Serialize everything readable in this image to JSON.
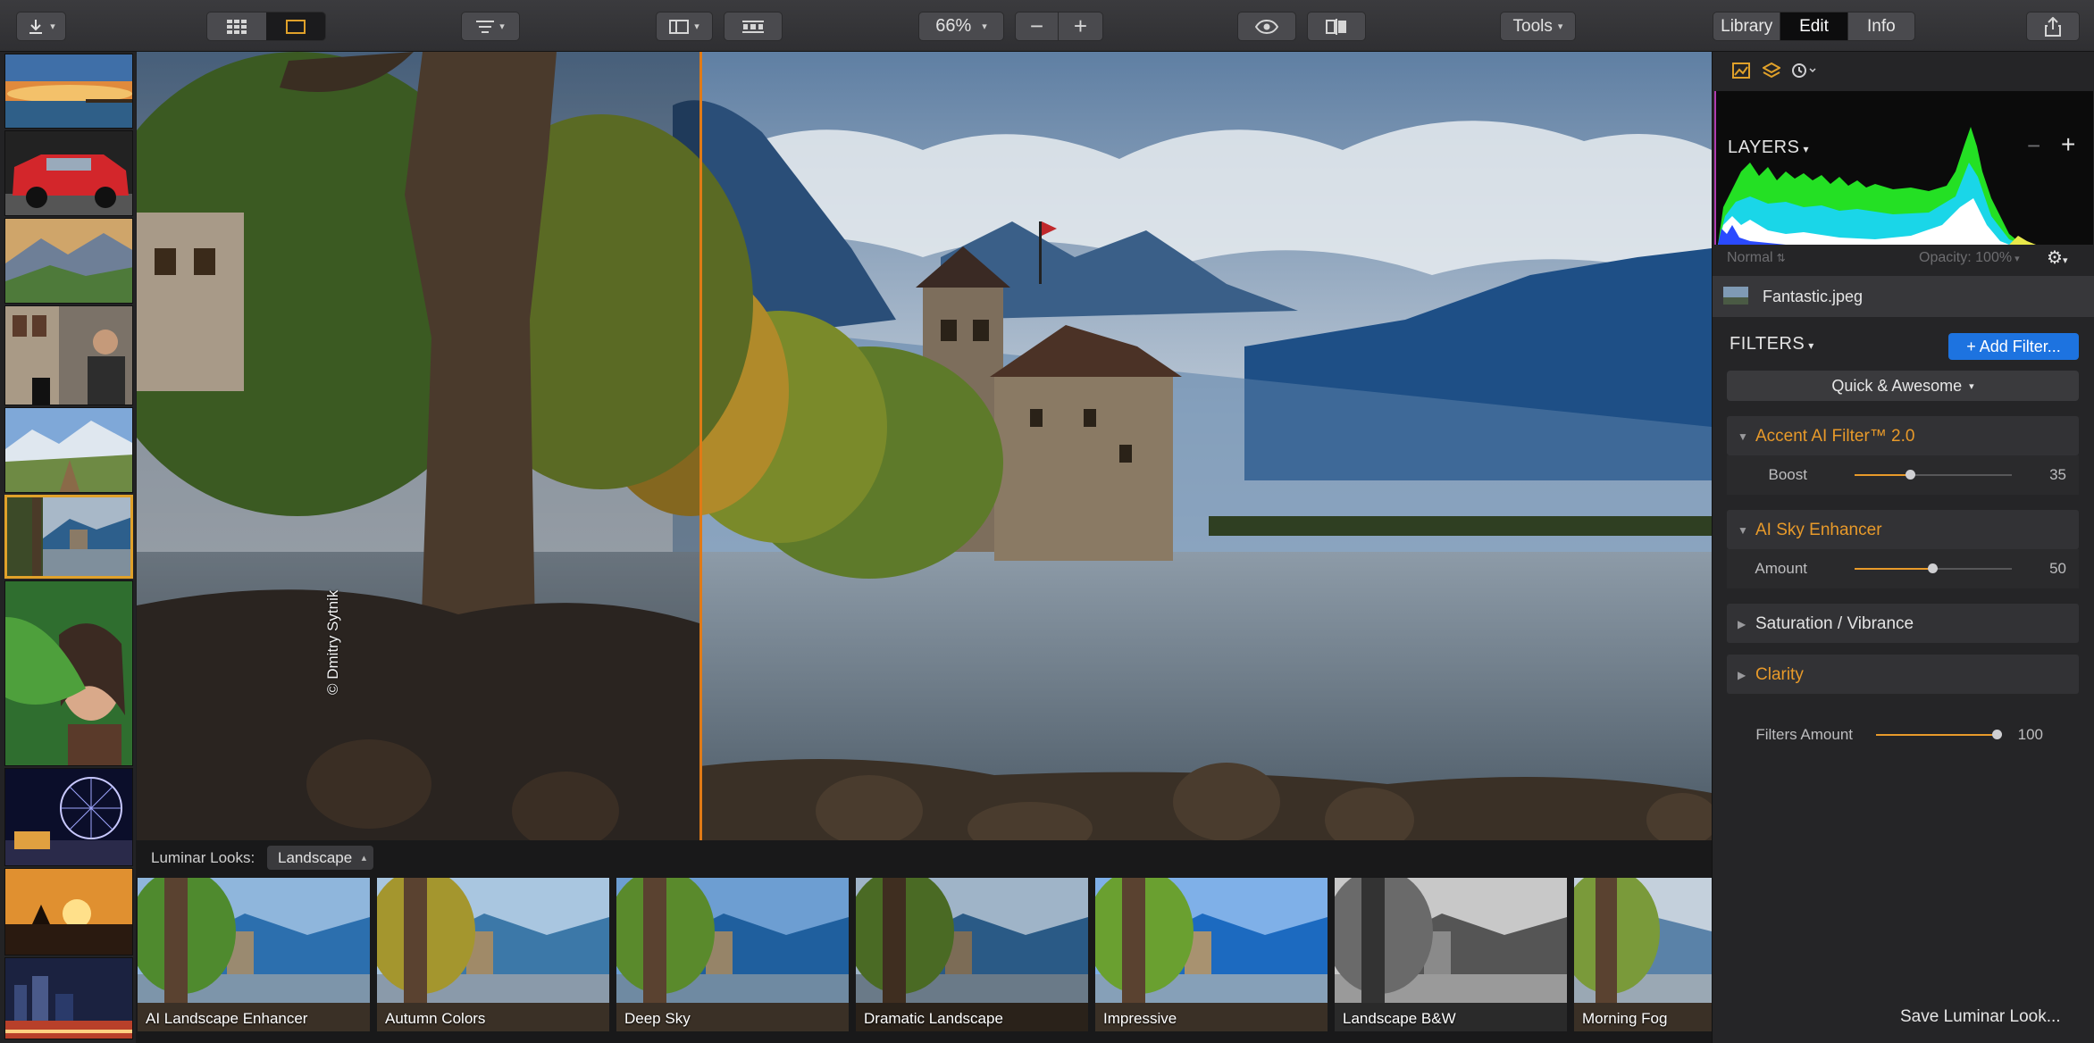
{
  "toolbar": {
    "zoom": "66%",
    "tools_label": "Tools",
    "tabs": [
      "Library",
      "Edit",
      "Info"
    ],
    "active_tab": "Edit"
  },
  "filmstrip": {
    "thumbnails": [
      "sunset-pier",
      "red-car",
      "mountain-valley",
      "street-musician",
      "mountain-trail",
      "castle-lake",
      "woman-leaf",
      "ferris-wheel-night",
      "sunset-rocks",
      "night-city"
    ],
    "selected_index": 5
  },
  "canvas": {
    "watermark": "© Dmitry Sytnik",
    "split_divider": true
  },
  "looks": {
    "label": "Luminar Looks:",
    "category": "Landscape",
    "items": [
      {
        "name": "AI Landscape Enhancer",
        "style": "color"
      },
      {
        "name": "Autumn Colors",
        "style": "warm"
      },
      {
        "name": "Deep Sky",
        "style": "color"
      },
      {
        "name": "Dramatic Landscape",
        "style": "dramatic"
      },
      {
        "name": "Impressive",
        "style": "vivid"
      },
      {
        "name": "Landscape B&W",
        "style": "bw"
      },
      {
        "name": "Morning Fog",
        "style": "fog"
      }
    ]
  },
  "panel": {
    "layers": {
      "title": "LAYERS",
      "blend_mode": "Normal",
      "opacity_label": "Opacity:",
      "opacity_value": "100%",
      "items": [
        {
          "name": "Fantastic.jpeg"
        }
      ]
    },
    "filters": {
      "title": "FILTERS",
      "add_button": "+ Add Filter...",
      "preset": "Quick & Awesome",
      "items": [
        {
          "name": "Accent AI Filter™ 2.0",
          "expanded": true,
          "slider_label": "Boost",
          "value": "35",
          "percent": 35
        },
        {
          "name": "AI Sky Enhancer",
          "expanded": true,
          "slider_label": "Amount",
          "value": "50",
          "percent": 50
        },
        {
          "name": "Saturation / Vibrance",
          "expanded": false
        },
        {
          "name": "Clarity",
          "expanded": false
        }
      ],
      "amount_label": "Filters Amount",
      "amount_value": "100",
      "amount_percent": 100
    },
    "save_look": "Save Luminar Look..."
  },
  "colors": {
    "accent": "#e89a2a",
    "button_blue": "#1d73e0",
    "background": "#252527"
  }
}
